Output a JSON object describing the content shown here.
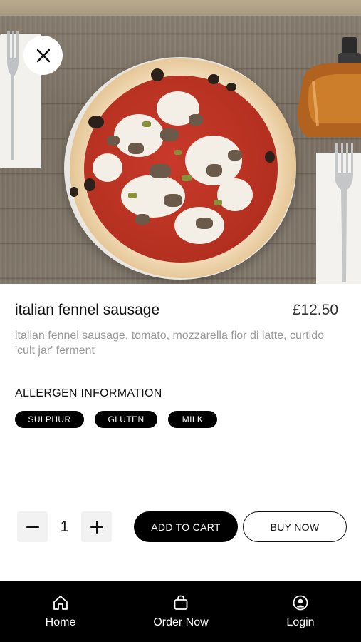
{
  "product": {
    "name": "italian fennel sausage",
    "price": "£12.50",
    "description": "italian fennel sausage, tomato, mozzarella fior di latte, curtido 'cult jar' ferment"
  },
  "allergens": {
    "heading": "ALLERGEN INFORMATION",
    "items": [
      "SULPHUR",
      "GLUTEN",
      "MILK"
    ]
  },
  "cart": {
    "quantity": "1",
    "add_to_cart_label": "ADD TO CART",
    "buy_now_label": "BUY NOW"
  },
  "nav": {
    "items": [
      {
        "label": "Home",
        "icon": "home-icon"
      },
      {
        "label": "Order Now",
        "icon": "shopping-bag-icon"
      },
      {
        "label": "Login",
        "icon": "user-circle-icon"
      }
    ]
  },
  "icons": {
    "close": "close-icon",
    "minus": "minus-icon",
    "plus": "plus-icon"
  },
  "colors": {
    "primary": "#000000",
    "background": "#ffffff",
    "muted_text": "#9a9a9a",
    "chip_text": "#ffffff"
  }
}
